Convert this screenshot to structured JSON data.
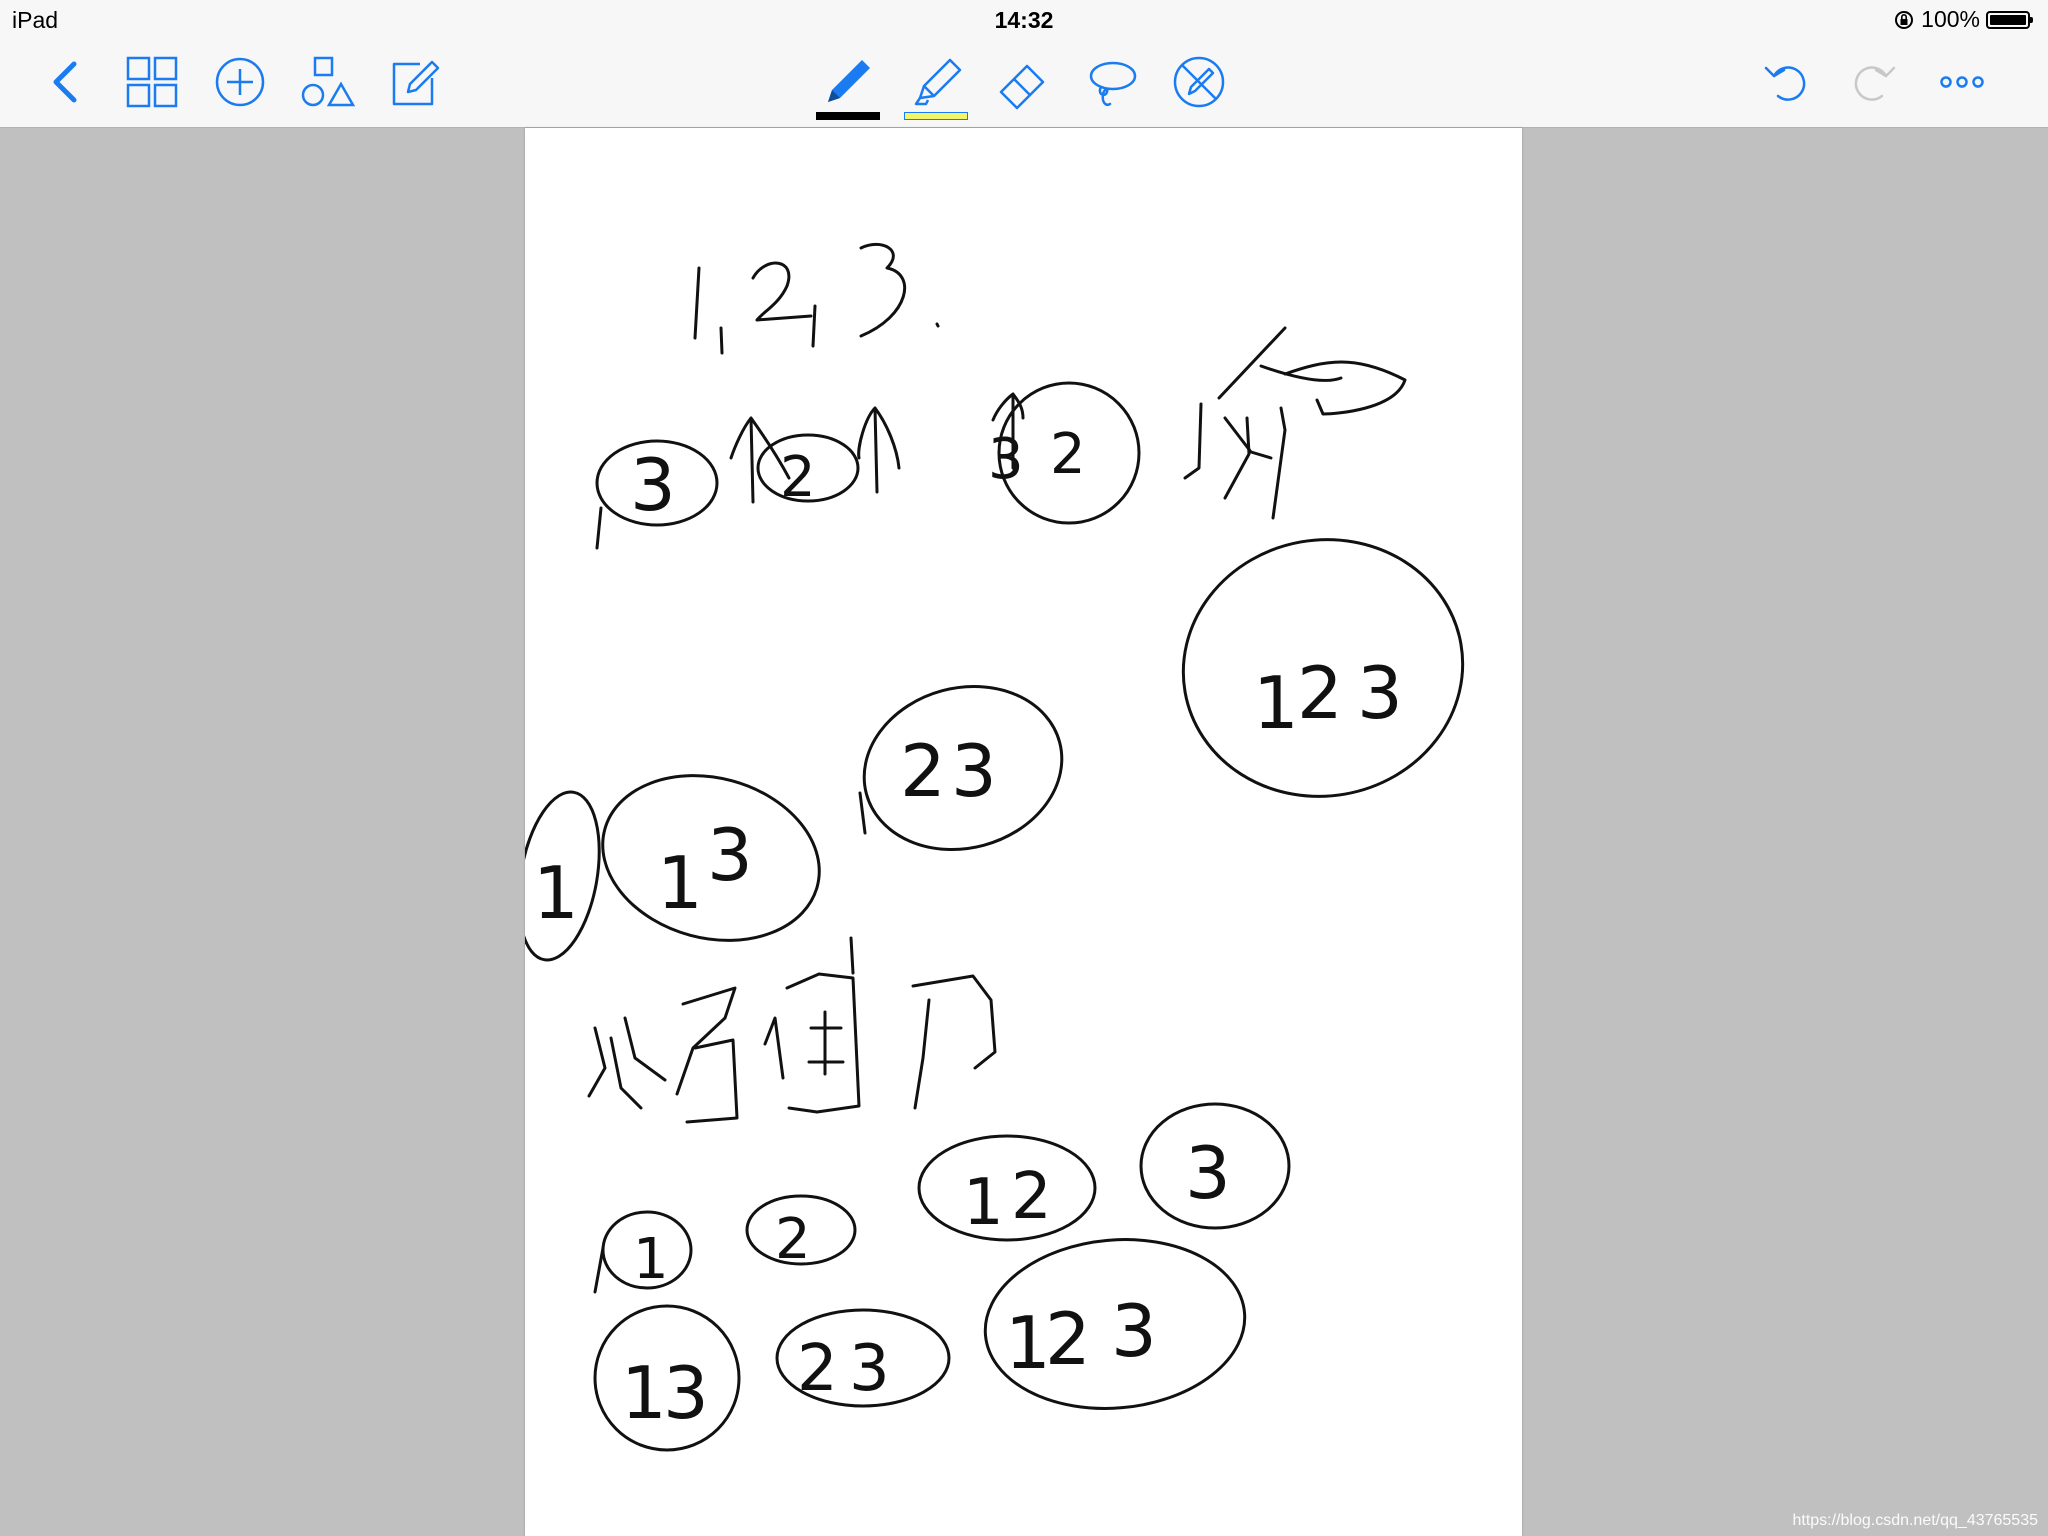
{
  "status_bar": {
    "device": "iPad",
    "time": "14:32",
    "battery": "100%"
  },
  "toolbar": {
    "left_icons": [
      "back-chevron-icon",
      "grid-view-icon",
      "add-circle-icon",
      "shapes-icon",
      "compose-icon"
    ],
    "drawing_tools": [
      "pen-icon",
      "highlighter-icon",
      "eraser-icon",
      "lasso-icon",
      "disable-pen-icon"
    ],
    "right_icons": [
      "undo-icon",
      "redo-icon",
      "more-icon"
    ],
    "accent_color": "#1a7cf0",
    "pen_color": "#000000",
    "highlighter_color": "#f0f56a",
    "redo_disabled_color": "#c8c8c8"
  },
  "page": {
    "background": "#ffffff",
    "handwriting": [
      "1, 2, 3",
      "↑ ↑ ↑",
      "3",
      "2",
      "32",
      "123",
      "1",
      "13",
      "23",
      "1",
      "2",
      "12",
      "3",
      "13",
      "23",
      "123"
    ]
  },
  "watermark": "https://blog.csdn.net/qq_43765535"
}
